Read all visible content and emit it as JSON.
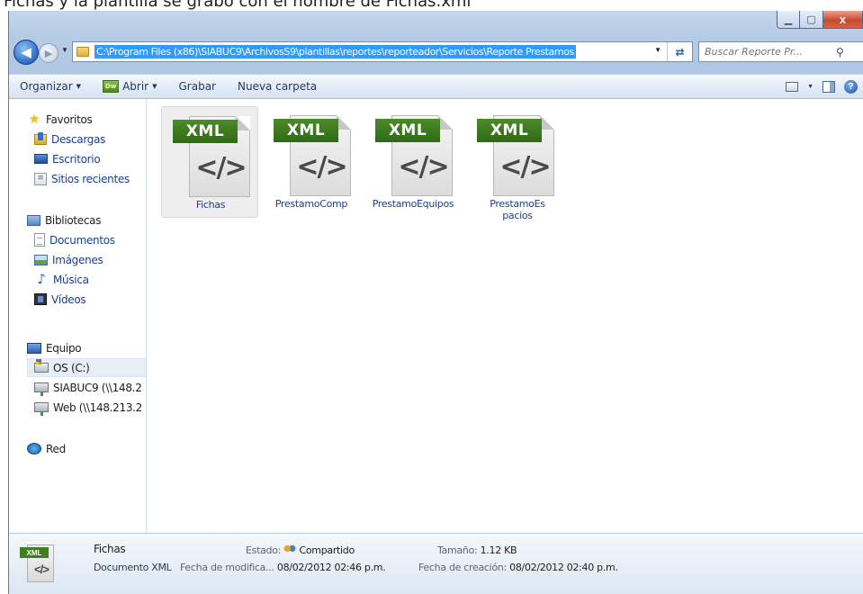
{
  "caption_above": "Fichas y la plantilla se grabó con el nombre de Fichas.xml",
  "window": {
    "address": "C:\\Program Files (x86)\\SIABUC9\\ArchivosS9\\plantillas\\reportes\\reporteador\\Servicios\\Reporte Prestamos",
    "search_placeholder": "Buscar Reporte Pr...",
    "buttons": {
      "minimize": "▁",
      "maximize": "▢",
      "close": "x"
    }
  },
  "toolbar": {
    "organize": "Organizar",
    "open": "Abrir",
    "open_icon_text": "Dw",
    "burn": "Grabar",
    "new_folder": "Nueva carpeta"
  },
  "nav": {
    "favorites": {
      "label": "Favoritos",
      "items": [
        "Descargas",
        "Escritorio",
        "Sitios recientes"
      ]
    },
    "libraries": {
      "label": "Bibliotecas",
      "items": [
        "Documentos",
        "Imágenes",
        "Música",
        "Vídeos"
      ]
    },
    "computer": {
      "label": "Equipo",
      "items": [
        "OS (C:)",
        "SIABUC9 (\\\\148.2",
        "Web (\\\\148.213.2"
      ]
    },
    "network": {
      "label": "Red"
    }
  },
  "files": [
    {
      "name": "Fichas",
      "tag": "XML",
      "code": "</>"
    },
    {
      "name": "PrestamoComp",
      "tag": "XML",
      "code": "</>"
    },
    {
      "name": "PrestamoEquipos",
      "tag": "XML",
      "code": "</>"
    },
    {
      "name": "PrestamoEspacios",
      "tag": "XML",
      "code": "</>"
    }
  ],
  "details": {
    "name": "Fichas",
    "type": "Documento XML",
    "state_label": "Estado:",
    "state_value": "Compartido",
    "size_label": "Tamaño:",
    "size_value": "1.12 KB",
    "modified_label": "Fecha de modifica...",
    "modified_value": "08/02/2012 02:46 p.m.",
    "created_label": "Fecha de creación:",
    "created_value": "08/02/2012 02:40 p.m.",
    "thumb_tag": "XML",
    "thumb_code": "</>"
  },
  "colors": {
    "link": "#1a3f8c",
    "selection_address": "#3399ff",
    "xml_badge": "#3f7f22"
  }
}
